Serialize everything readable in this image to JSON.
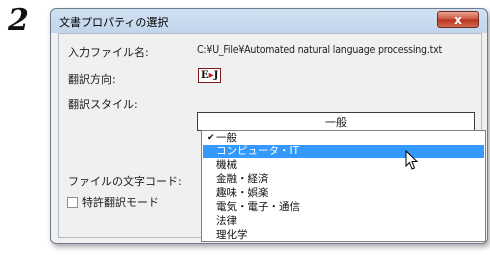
{
  "step_number": "2",
  "dialog": {
    "title": "文書プロパティの選択",
    "close_label": "x"
  },
  "fields": {
    "input_file_label": "入力ファイル名:",
    "input_file_value": "C:¥U_File¥Automated natural language processing.txt",
    "direction_label": "翻訳方向:",
    "direction_from": "E",
    "direction_arrow": "▸",
    "direction_to": "J",
    "style_label": "翻訳スタイル:",
    "style_value": "一般",
    "encoding_label": "ファイルの文字コード:",
    "patent_mode_label": "特許翻訳モード"
  },
  "style_options": [
    {
      "label": "一般",
      "checked": true,
      "selected": false
    },
    {
      "label": "コンピュータ・IT",
      "checked": false,
      "selected": true
    },
    {
      "label": "機械",
      "checked": false,
      "selected": false
    },
    {
      "label": "金融・経済",
      "checked": false,
      "selected": false
    },
    {
      "label": "趣味・娯楽",
      "checked": false,
      "selected": false
    },
    {
      "label": "電気・電子・通信",
      "checked": false,
      "selected": false
    },
    {
      "label": "法律",
      "checked": false,
      "selected": false
    },
    {
      "label": "理化学",
      "checked": false,
      "selected": false
    }
  ],
  "colors": {
    "selection": "#3399ff",
    "close_button": "#c9503a",
    "titlebar": "#c2d6ec"
  },
  "icons": {
    "check": "check-icon",
    "cursor": "mouse-pointer-icon",
    "close": "close-icon"
  }
}
